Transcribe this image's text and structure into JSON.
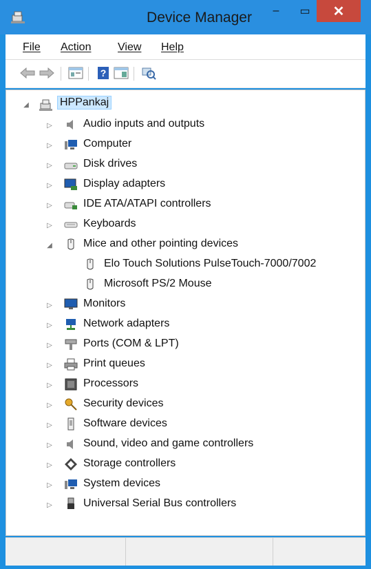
{
  "window": {
    "title": "Device Manager",
    "minimize": "–",
    "maximize": "▭",
    "close": "✕"
  },
  "menu": [
    {
      "label": "File"
    },
    {
      "label": "Action"
    },
    {
      "label": "View"
    },
    {
      "label": "Help"
    }
  ],
  "toolbar": {
    "back": "back-arrow-icon",
    "forward": "forward-arrow-icon",
    "properties": "properties-icon",
    "help": "help-icon",
    "show-hide": "show-hide-console-icon",
    "scan": "scan-hardware-icon"
  },
  "tree": {
    "root": "HPPankaj",
    "categories": [
      {
        "label": "Audio inputs and outputs"
      },
      {
        "label": "Computer"
      },
      {
        "label": "Disk drives"
      },
      {
        "label": "Display adapters"
      },
      {
        "label": "IDE ATA/ATAPI controllers"
      },
      {
        "label": "Keyboards"
      },
      {
        "label": "Mice and other pointing devices",
        "expanded": true
      },
      {
        "label": "Monitors"
      },
      {
        "label": "Network adapters"
      },
      {
        "label": "Ports (COM & LPT)"
      },
      {
        "label": "Print queues"
      },
      {
        "label": "Processors"
      },
      {
        "label": "Security devices"
      },
      {
        "label": "Software devices"
      },
      {
        "label": "Sound, video and game controllers"
      },
      {
        "label": "Storage controllers"
      },
      {
        "label": "System devices"
      },
      {
        "label": "Universal Serial Bus controllers"
      }
    ],
    "mice_children": [
      {
        "label": "Elo Touch Solutions PulseTouch-7000/7002"
      },
      {
        "label": "Microsoft PS/2 Mouse"
      }
    ]
  },
  "colors": {
    "titlebar": "#2a8fe0",
    "close": "#c7493d",
    "selection": "#cce8ff"
  }
}
